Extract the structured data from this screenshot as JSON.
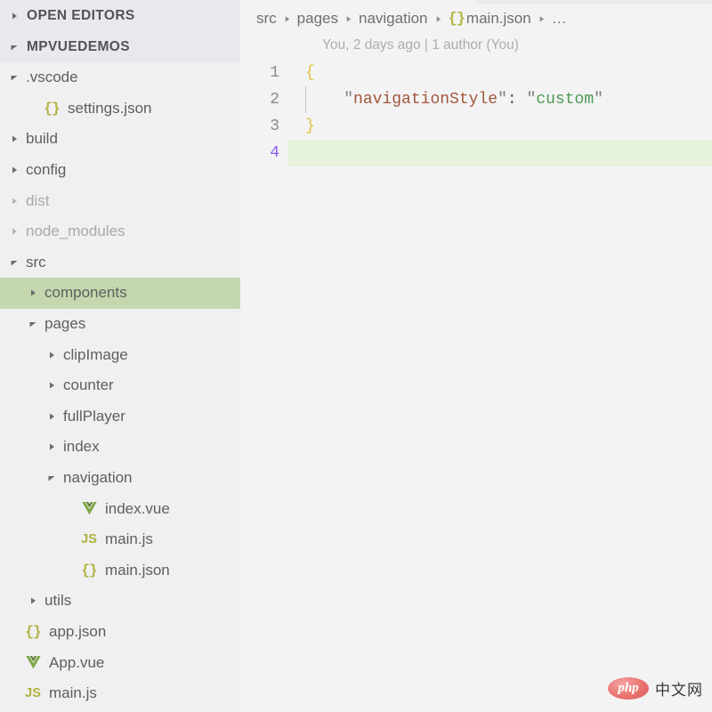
{
  "sidebar": {
    "panes": [
      {
        "title": "OPEN EDITORS",
        "twisty": "collapsed"
      },
      {
        "title": "MPVUEDEMOS",
        "twisty": "expanded"
      }
    ],
    "tree": [
      {
        "label": ".vscode",
        "depth": 1,
        "twisty": "expanded",
        "icon": "none",
        "dimmed": false,
        "selected": false
      },
      {
        "label": "settings.json",
        "depth": 2,
        "twisty": "none",
        "icon": "json",
        "dimmed": false,
        "selected": false
      },
      {
        "label": "build",
        "depth": 1,
        "twisty": "collapsed",
        "icon": "none",
        "dimmed": false,
        "selected": false
      },
      {
        "label": "config",
        "depth": 1,
        "twisty": "collapsed",
        "icon": "none",
        "dimmed": false,
        "selected": false
      },
      {
        "label": "dist",
        "depth": 1,
        "twisty": "collapsed",
        "icon": "none",
        "dimmed": true,
        "selected": false
      },
      {
        "label": "node_modules",
        "depth": 1,
        "twisty": "collapsed",
        "icon": "none",
        "dimmed": true,
        "selected": false
      },
      {
        "label": "src",
        "depth": 1,
        "twisty": "expanded",
        "icon": "none",
        "dimmed": false,
        "selected": false
      },
      {
        "label": "components",
        "depth": 2,
        "twisty": "collapsed",
        "icon": "none",
        "dimmed": false,
        "selected": true
      },
      {
        "label": "pages",
        "depth": 2,
        "twisty": "expanded",
        "icon": "none",
        "dimmed": false,
        "selected": false
      },
      {
        "label": "clipImage",
        "depth": 3,
        "twisty": "collapsed",
        "icon": "none",
        "dimmed": false,
        "selected": false
      },
      {
        "label": "counter",
        "depth": 3,
        "twisty": "collapsed",
        "icon": "none",
        "dimmed": false,
        "selected": false
      },
      {
        "label": "fullPlayer",
        "depth": 3,
        "twisty": "collapsed",
        "icon": "none",
        "dimmed": false,
        "selected": false
      },
      {
        "label": "index",
        "depth": 3,
        "twisty": "collapsed",
        "icon": "none",
        "dimmed": false,
        "selected": false
      },
      {
        "label": "navigation",
        "depth": 3,
        "twisty": "expanded",
        "icon": "none",
        "dimmed": false,
        "selected": false
      },
      {
        "label": "index.vue",
        "depth": 4,
        "twisty": "none",
        "icon": "vue",
        "dimmed": false,
        "selected": false
      },
      {
        "label": "main.js",
        "depth": 4,
        "twisty": "none",
        "icon": "js",
        "dimmed": false,
        "selected": false
      },
      {
        "label": "main.json",
        "depth": 4,
        "twisty": "none",
        "icon": "json",
        "dimmed": false,
        "selected": false
      },
      {
        "label": "utils",
        "depth": 2,
        "twisty": "collapsed",
        "icon": "none",
        "dimmed": false,
        "selected": false
      },
      {
        "label": "app.json",
        "depth": 1,
        "twisty": "none",
        "icon": "json",
        "dimmed": false,
        "selected": false
      },
      {
        "label": "App.vue",
        "depth": 1,
        "twisty": "none",
        "icon": "vue",
        "dimmed": false,
        "selected": false
      },
      {
        "label": "main.js",
        "depth": 1,
        "twisty": "none",
        "icon": "js",
        "dimmed": false,
        "selected": false
      }
    ]
  },
  "editor": {
    "breadcrumb": [
      {
        "text": "src",
        "icon": ""
      },
      {
        "text": "pages",
        "icon": ""
      },
      {
        "text": "navigation",
        "icon": ""
      },
      {
        "text": "main.json",
        "icon": "{}"
      },
      {
        "text": "…",
        "icon": ""
      }
    ],
    "blame": "You, 2 days ago | 1 author (You)",
    "lines": [
      {
        "num": "1",
        "active": false,
        "indent_guide": false,
        "tokens": [
          {
            "t": "{",
            "c": "brace"
          }
        ]
      },
      {
        "num": "2",
        "active": false,
        "indent_guide": true,
        "tokens": [
          {
            "t": "    ",
            "c": "plain"
          },
          {
            "t": "\"",
            "c": "quote"
          },
          {
            "t": "navigationStyle",
            "c": "key"
          },
          {
            "t": "\"",
            "c": "quote"
          },
          {
            "t": ":",
            "c": "colon"
          },
          {
            "t": " ",
            "c": "plain"
          },
          {
            "t": "\"",
            "c": "quote"
          },
          {
            "t": "custom",
            "c": "str"
          },
          {
            "t": "\"",
            "c": "quote"
          }
        ]
      },
      {
        "num": "3",
        "active": false,
        "indent_guide": false,
        "tokens": [
          {
            "t": "}",
            "c": "brace"
          }
        ]
      },
      {
        "num": "4",
        "active": true,
        "indent_guide": false,
        "tokens": []
      }
    ]
  },
  "watermark": {
    "logo": "php",
    "text": "中文网"
  },
  "colors": {
    "sidebar_bg": "#f0f0f1",
    "editor_bg": "#f3f3f4",
    "pane_header_bg": "#eae8ef",
    "selection_green": "#c5d7ae",
    "active_line_green": "#e7f2da",
    "json_icon": "#b3b343",
    "vue_icon": "#7ea849",
    "js_icon": "#b0b13c",
    "string_green": "#4e9a52",
    "key_brown": "#a3563b",
    "brace_yellow": "#e3c341",
    "active_line_number": "#8b5cf6"
  }
}
